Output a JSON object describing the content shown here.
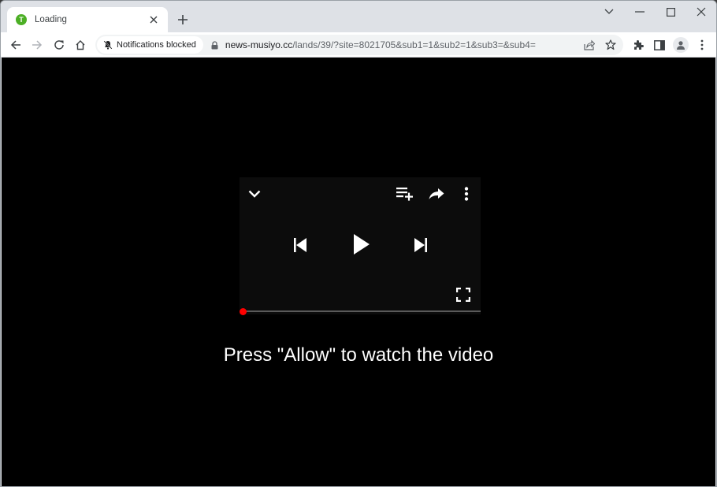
{
  "browser": {
    "tab": {
      "title": "Loading",
      "favicon_letter": "T",
      "favicon_color": "#4caf25"
    },
    "new_tab_label": "+",
    "window_controls": [
      "tab-search",
      "minimize",
      "maximize",
      "close"
    ],
    "toolbar": {
      "back_enabled": true,
      "forward_enabled": false,
      "notifications_chip": "Notifications blocked",
      "url_host": "news-musiyo.cc",
      "url_path": "/lands/39/?site=8021705&sub1=1&sub2=1&sub3=&sub4="
    }
  },
  "page": {
    "background": "#000000",
    "player": {
      "top_icons": [
        "chevron-down",
        "add-to-queue",
        "share",
        "more-vertical"
      ],
      "center_icons": [
        "skip-previous",
        "play",
        "skip-next"
      ],
      "bottom_icons": [
        "fullscreen"
      ],
      "progress_fraction": 0,
      "accent_color": "#ff0000"
    },
    "caption": "Press \"Allow\" to watch the video"
  }
}
